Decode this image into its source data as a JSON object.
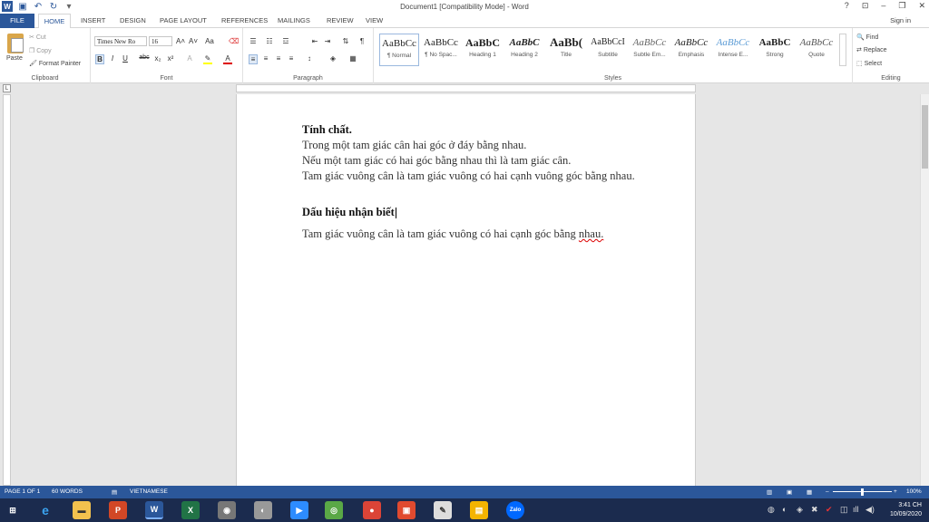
{
  "window": {
    "title": "Document1 [Compatibility Mode] - Word",
    "buttons": [
      "?",
      "⊡",
      "–",
      "❐",
      "✕"
    ]
  },
  "qat": {
    "save_icon": "save-icon",
    "undo_icon": "undo-icon",
    "redo_icon": "redo-icon"
  },
  "tabs": [
    "FILE",
    "HOME",
    "INSERT",
    "DESIGN",
    "PAGE LAYOUT",
    "REFERENCES",
    "MAILINGS",
    "REVIEW",
    "VIEW"
  ],
  "signin": "Sign in",
  "clipboard": {
    "paste": "Paste",
    "cut": "Cut",
    "copy": "Copy",
    "format_painter": "Format Painter",
    "label": "Clipboard"
  },
  "font": {
    "name": "Times New Ro",
    "size": "16",
    "label": "Font",
    "bold": "B",
    "italic": "I",
    "underline": "U",
    "strike": "abc",
    "sub": "x₂",
    "sup": "x²"
  },
  "paragraph": {
    "label": "Paragraph"
  },
  "styles": {
    "label": "Styles",
    "items": [
      {
        "sample": "AaBbCc",
        "name": "¶ Normal"
      },
      {
        "sample": "AaBbCc",
        "name": "¶ No Spac..."
      },
      {
        "sample": "AaBbC",
        "name": "Heading 1"
      },
      {
        "sample": "AaBbC",
        "name": "Heading 2"
      },
      {
        "sample": "AaBb(",
        "name": "Title"
      },
      {
        "sample": "AaBbCcI",
        "name": "Subtitle"
      },
      {
        "sample": "AaBbCc",
        "name": "Subtle Em..."
      },
      {
        "sample": "AaBbCc",
        "name": "Emphasis"
      },
      {
        "sample": "AaBbCc",
        "name": "Intense E..."
      },
      {
        "sample": "AaBbC",
        "name": "Strong"
      },
      {
        "sample": "AaBbCc",
        "name": "Quote"
      }
    ]
  },
  "editing": {
    "find": "Find",
    "replace": "Replace",
    "select": "Select",
    "label": "Editing"
  },
  "document": {
    "heading1": "Tính chất.",
    "line1": "Trong một tam giác cân hai góc ở đáy bằng nhau.",
    "line2": "Nếu một tam giác có hai góc bằng nhau thì là tam giác cân.",
    "line3": "Tam giác vuông cân là tam giác vuông có hai cạnh vuông góc bằng nhau.",
    "heading2": "Dấu hiệu nhận biết",
    "line4_main": "Tam giác vuông cân là tam giác vuông có hai cạnh góc bằng ",
    "line4_err": "nhau."
  },
  "status": {
    "page": "PAGE 1 OF 1",
    "words": "60 WORDS",
    "language": "VIETNAMESE",
    "zoom": "100%"
  },
  "taskbar": {
    "time": "3:41 CH",
    "date": "10/09/2020"
  },
  "colors": {
    "accent": "#2b579a",
    "taskbar": "#1b2b4e"
  }
}
